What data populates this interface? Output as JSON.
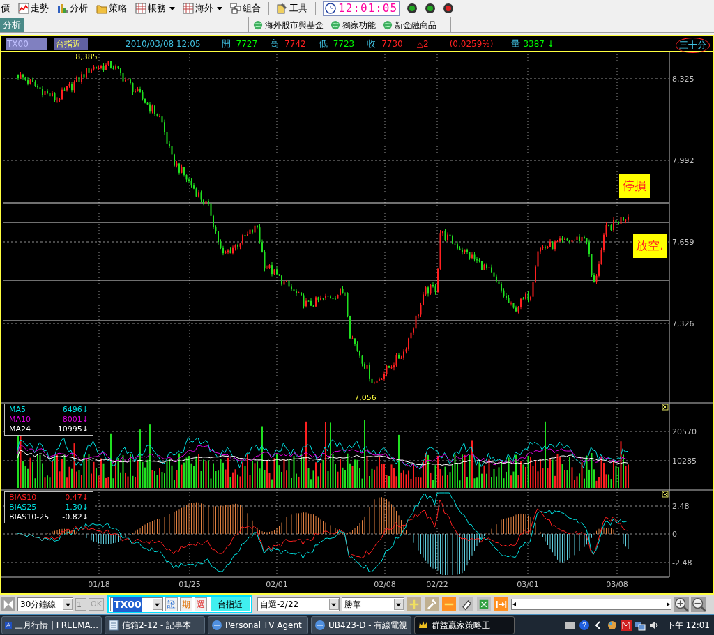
{
  "toolbar": {
    "items": [
      {
        "label": "價",
        "kind": "plain",
        "dropdown": false
      },
      {
        "label": "走勢",
        "kind": "trend",
        "dropdown": false
      },
      {
        "label": "分析",
        "kind": "bars",
        "dropdown": false
      },
      {
        "label": "策略",
        "kind": "folder",
        "dropdown": false
      },
      {
        "label": "帳務",
        "kind": "grid",
        "dropdown": true
      },
      {
        "label": "海外",
        "kind": "grid",
        "dropdown": true
      },
      {
        "label": "組合",
        "kind": "windows",
        "dropdown": false
      },
      {
        "label": "工具",
        "kind": "tools",
        "dropdown": false
      }
    ],
    "clock": "12:01:05",
    "lights": [
      {
        "color": "#22aa22"
      },
      {
        "color": "#22aa22"
      },
      {
        "color": "#dd2222"
      }
    ]
  },
  "subbar": {
    "tab": "分析",
    "links": [
      "海外股市與基金",
      "獨家功能",
      "新金融商品"
    ]
  },
  "quote_header": {
    "symbol": "TX00",
    "contract": "台指近",
    "datetime": "2010/03/08 12:05",
    "fields": [
      {
        "label": "開",
        "value": "7727",
        "rising": false
      },
      {
        "label": "高",
        "value": "7742",
        "rising": true
      },
      {
        "label": "低",
        "value": "7723",
        "rising": false
      },
      {
        "label": "收",
        "value": "7730",
        "rising": true
      }
    ],
    "change": "△2",
    "change_pct": "(0.0259%)",
    "volume_label": "量",
    "volume": "3387 ↓",
    "period": "三十分"
  },
  "price_panel": {
    "axis_labels": [
      "8,325",
      "7,992",
      "7,659",
      "7,326"
    ],
    "high_label": "8,385",
    "low_label": "7,056",
    "annotations": [
      {
        "label": "停損"
      },
      {
        "label": "放空."
      }
    ]
  },
  "volume_panel": {
    "legend": [
      {
        "name": "MA5",
        "value": "6496↓",
        "color": "#00e0e0"
      },
      {
        "name": "MA10",
        "value": "8001↓",
        "color": "#e000e0"
      },
      {
        "name": "MA24",
        "value": "10995↓",
        "color": "#ffffff"
      }
    ],
    "axis_labels": [
      "20570",
      "10285"
    ]
  },
  "bias_panel": {
    "legend": [
      {
        "name": "BIAS10",
        "value": "0.47↓",
        "color": "#ff2020"
      },
      {
        "name": "BIAS25",
        "value": "1.30↓",
        "color": "#00e0e0"
      },
      {
        "name": "BIAS10-25",
        "value": "-0.82↓",
        "color": "#ffffff"
      }
    ],
    "axis_labels": [
      "2.48",
      "0",
      "-2.48"
    ]
  },
  "x_axis": [
    "01/18",
    "01/25",
    "02/01",
    "02/08",
    "02/22",
    "03/01",
    "03/08"
  ],
  "bottom_toolbar": {
    "period": "30分鐘線",
    "count": "1",
    "ok": {
      "label": "OK",
      "disabled": true
    },
    "symbol": "TX00",
    "markets": [
      {
        "label": "證",
        "kind": "stock"
      },
      {
        "label": "期",
        "kind": "futures"
      },
      {
        "label": "選",
        "kind": "options"
      }
    ],
    "contract": "台指近",
    "watchlist": "自選-2/22",
    "stock": "勝華"
  },
  "taskbar": {
    "tasks": [
      {
        "label": "三月行情 | FREEMA...",
        "selected": false
      },
      {
        "label": "信箱2-12 - 記事本",
        "selected": false
      },
      {
        "label": "Personal TV Agent",
        "selected": false
      },
      {
        "label": "UB423-D - 有線電視",
        "selected": false
      },
      {
        "label": "群益贏家策略王",
        "selected": true
      }
    ],
    "clock": "下午 12:01"
  }
}
